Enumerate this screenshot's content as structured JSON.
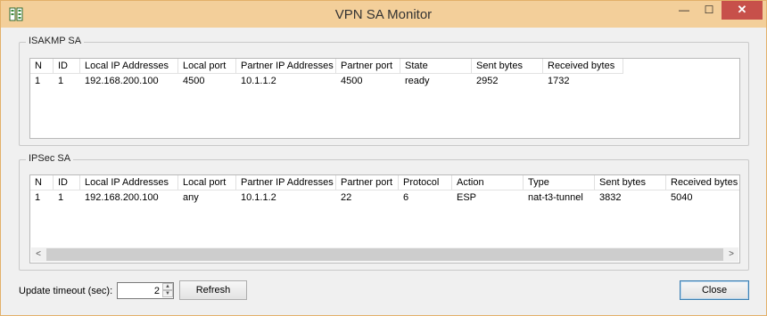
{
  "window": {
    "title": "VPN SA Monitor",
    "minimize_glyph": "—",
    "maximize_glyph": "☐",
    "close_glyph": "✕",
    "app_icon": "network-monitor-icon"
  },
  "isakmp": {
    "title": "ISAKMP SA",
    "columns": [
      "N",
      "ID",
      "Local IP Addresses",
      "Local port",
      "Partner IP Addresses",
      "Partner port",
      "State",
      "Sent bytes",
      "Received bytes"
    ],
    "rows": [
      [
        "1",
        "1",
        "192.168.200.100",
        "4500",
        "10.1.1.2",
        "4500",
        "ready",
        "2952",
        "1732"
      ]
    ]
  },
  "ipsec": {
    "title": "IPSec SA",
    "columns": [
      "N",
      "ID",
      "Local IP Addresses",
      "Local port",
      "Partner IP Addresses",
      "Partner port",
      "Protocol",
      "Action",
      "Type",
      "Sent bytes",
      "Received bytes"
    ],
    "rows": [
      [
        "1",
        "1",
        "192.168.200.100",
        "any",
        "10.1.1.2",
        "22",
        "6",
        "ESP",
        "nat-t3-tunnel",
        "3832",
        "5040"
      ]
    ],
    "scroll_left": "<",
    "scroll_right": ">"
  },
  "footer": {
    "timeout_label": "Update timeout (sec):",
    "timeout_value": "2",
    "spin_up": "▲",
    "spin_down": "▼",
    "refresh_label": "Refresh",
    "close_label": "Close"
  }
}
